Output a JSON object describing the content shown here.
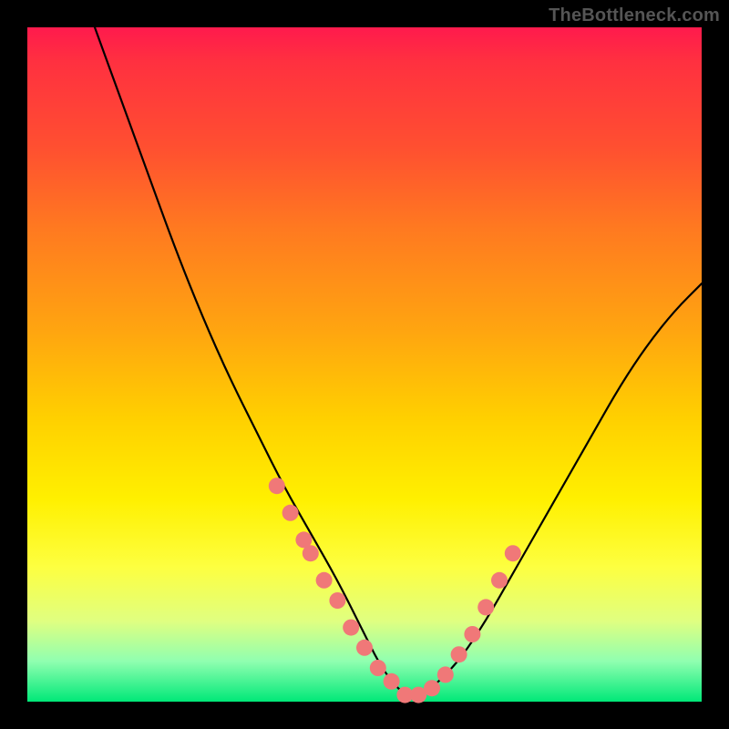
{
  "watermark": "TheBottleneck.com",
  "chart_data": {
    "type": "line",
    "title": "",
    "xlabel": "",
    "ylabel": "",
    "xlim": [
      0,
      100
    ],
    "ylim": [
      0,
      100
    ],
    "series": [
      {
        "name": "bottleneck-curve",
        "x": [
          10,
          14,
          18,
          22,
          26,
          30,
          34,
          38,
          42,
          46,
          50,
          52,
          54,
          56,
          58,
          60,
          64,
          68,
          72,
          76,
          80,
          84,
          88,
          92,
          96,
          100
        ],
        "values": [
          100,
          89,
          78,
          67,
          57,
          48,
          40,
          32,
          25,
          18,
          10,
          6,
          3,
          1,
          1,
          2,
          6,
          12,
          19,
          26,
          33,
          40,
          47,
          53,
          58,
          62
        ]
      }
    ],
    "markers": {
      "name": "highlight-dots",
      "color": "#f07878",
      "x": [
        37,
        39,
        41,
        42,
        44,
        46,
        48,
        50,
        52,
        54,
        56,
        58,
        60,
        62,
        64,
        66,
        68,
        70,
        72
      ],
      "values": [
        32,
        28,
        24,
        22,
        18,
        15,
        11,
        8,
        5,
        3,
        1,
        1,
        2,
        4,
        7,
        10,
        14,
        18,
        22
      ]
    },
    "background_gradient": {
      "top": "#ff1a4d",
      "bottom": "#00e878"
    }
  }
}
